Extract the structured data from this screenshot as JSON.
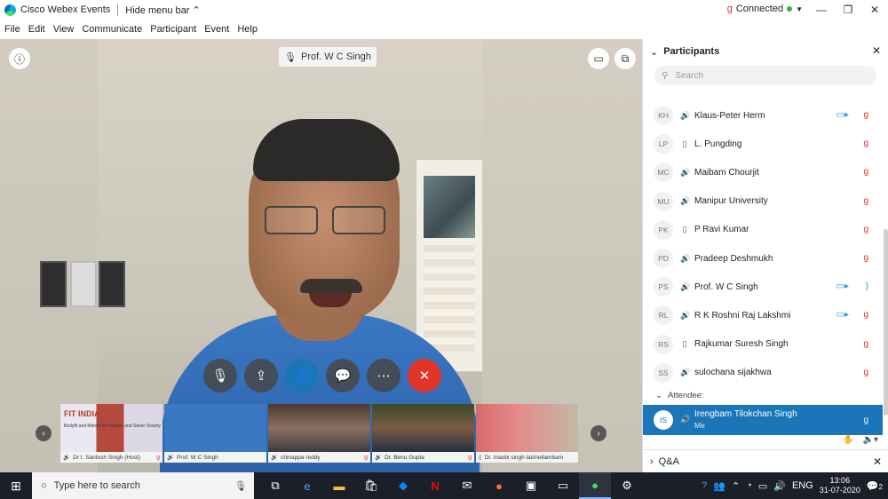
{
  "window": {
    "app_title": "Cisco Webex Events",
    "hide_menu_label": "Hide menu bar",
    "status": "Connected"
  },
  "menu": [
    "File",
    "Edit",
    "View",
    "Communicate",
    "Participant",
    "Event",
    "Help"
  ],
  "video": {
    "speaker_name": "Prof. W C Singh"
  },
  "filmstrip": [
    {
      "name": "Dr I. Santosh Singh (Host)",
      "banner": "FIT INDIA",
      "banner_sub": "Bodyfit and Mindfit for Healthy and Saner Society"
    },
    {
      "name": "Prof. W C Singh"
    },
    {
      "name": "chinappa reddy"
    },
    {
      "name": "Dr. Benu Gupta"
    },
    {
      "name": "Dr. Inaobi singh laishellambam"
    }
  ],
  "panel": {
    "title": "Participants",
    "search_placeholder": "Search",
    "participants": [
      {
        "initials": "KH",
        "name": "Klaus-Peter Herm",
        "video": true,
        "muted": true
      },
      {
        "initials": "LP",
        "name": "L. Pungding",
        "video": false,
        "muted": true
      },
      {
        "initials": "MC",
        "name": "Maibam Chourjit",
        "video": false,
        "muted": true
      },
      {
        "initials": "MU",
        "name": "Manipur University",
        "video": false,
        "muted": true
      },
      {
        "initials": "PK",
        "name": "P Ravi Kumar",
        "video": false,
        "muted": true
      },
      {
        "initials": "PD",
        "name": "Pradeep Deshmukh",
        "video": false,
        "muted": true
      },
      {
        "initials": "PS",
        "name": "Prof. W C Singh",
        "video": true,
        "muted": false
      },
      {
        "initials": "RL",
        "name": "R K Roshni Raj Lakshmi",
        "video": true,
        "muted": true
      },
      {
        "initials": "RS",
        "name": "Rajkumar Suresh Singh",
        "video": false,
        "muted": true
      },
      {
        "initials": "SS",
        "name": "sulochana sijakhwa",
        "video": false,
        "muted": true
      }
    ],
    "attendee_label": "Attendee:",
    "me": {
      "initials": "IS",
      "name": "Irengbam Tilokchan Singh",
      "sub": "Me"
    },
    "qa_label": "Q&A"
  },
  "taskbar": {
    "search_placeholder": "Type here to search",
    "time": "13:06",
    "date": "31-07-2020",
    "notifications": "2"
  },
  "colors": {
    "accent": "#1a76b8",
    "leave": "#e2352a",
    "taskbar": "#1b1f27"
  }
}
